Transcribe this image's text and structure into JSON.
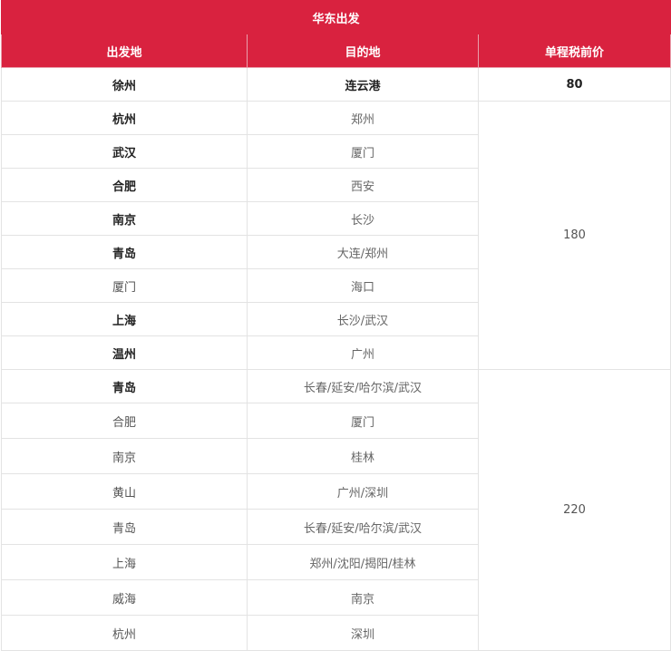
{
  "title": "华东出发",
  "headers": {
    "origin": "出发地",
    "destination": "目的地",
    "price": "单程税前价"
  },
  "rows": [
    {
      "origin": "徐州",
      "destination": "连云港"
    },
    {
      "origin": "杭州",
      "destination": "郑州"
    },
    {
      "origin": "武汉",
      "destination": "厦门"
    },
    {
      "origin": "合肥",
      "destination": "西安"
    },
    {
      "origin": "南京",
      "destination": "长沙"
    },
    {
      "origin": "青岛",
      "destination": "大连/郑州"
    },
    {
      "origin": "厦门",
      "destination": "海口"
    },
    {
      "origin": "上海",
      "destination": "长沙/武汉"
    },
    {
      "origin": "温州",
      "destination": "广州"
    },
    {
      "origin": "青岛",
      "destination": "长春/延安/哈尔滨/武汉"
    },
    {
      "origin": "合肥",
      "destination": "厦门"
    },
    {
      "origin": "南京",
      "destination": "桂林"
    },
    {
      "origin": "黄山",
      "destination": "广州/深圳"
    },
    {
      "origin": "青岛",
      "destination": "长春/延安/哈尔滨/武汉"
    },
    {
      "origin": "上海",
      "destination": "郑州/沈阳/揭阳/桂林"
    },
    {
      "origin": "威海",
      "destination": "南京"
    },
    {
      "origin": "杭州",
      "destination": "深圳"
    }
  ],
  "prices": {
    "group1": "80",
    "group2": "180",
    "group3": "220"
  }
}
